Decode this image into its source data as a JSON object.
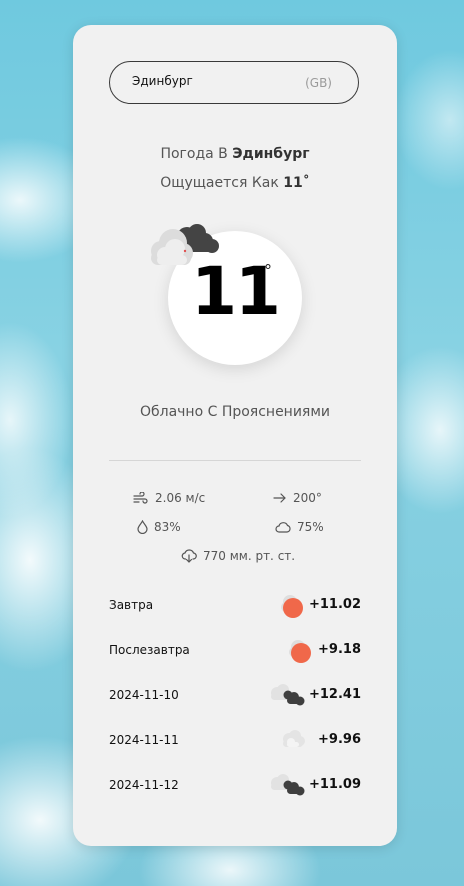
{
  "search": {
    "city": "Эдинбург",
    "country_code": "(GB)"
  },
  "header": {
    "prefix": "Погода В",
    "city": "Эдинбург",
    "feels_prefix": "Ощущается Как",
    "feels_value": "11˚"
  },
  "current": {
    "temperature": "11",
    "degree": "°",
    "icon": "cloudy-icon",
    "description": "Облачно С Прояснениями"
  },
  "stats": {
    "wind_speed": "2.06 м/с",
    "wind_direction": "200°",
    "humidity": "83%",
    "cloudiness": "75%",
    "pressure": "770 мм. рт. ст."
  },
  "forecast": [
    {
      "day": "Завтра",
      "temp": "+11.02",
      "icon": "sun-behind-cloud-icon"
    },
    {
      "day": "Послезавтра",
      "temp": "+9.18",
      "icon": "sun-behind-cloud-icon"
    },
    {
      "day": "2024-11-10",
      "temp": "+12.41",
      "icon": "dark-clouds-icon"
    },
    {
      "day": "2024-11-11",
      "temp": "+9.96",
      "icon": "light-cloud-icon"
    },
    {
      "day": "2024-11-12",
      "temp": "+11.09",
      "icon": "dark-clouds-icon"
    }
  ],
  "colors": {
    "sun": "#f0684a",
    "card": "#f1f1f1",
    "sky": "#7bc7da"
  }
}
